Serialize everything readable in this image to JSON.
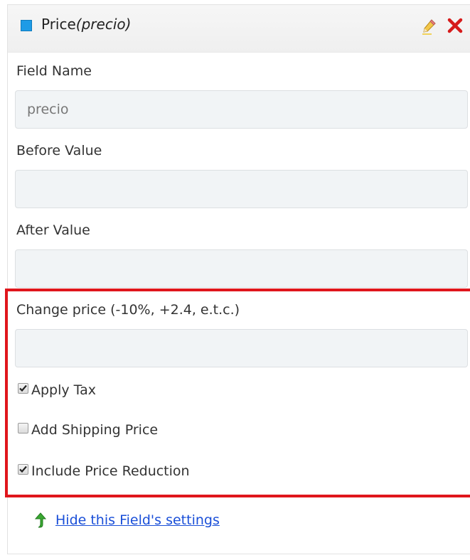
{
  "header": {
    "title_main": "Price",
    "title_key": "(precio)",
    "color": "#1e9be6",
    "edit_icon": "pencil-icon",
    "delete_icon": "close-icon"
  },
  "fields": {
    "field_name": {
      "label": "Field Name",
      "value": "precio",
      "placeholder": ""
    },
    "before_value": {
      "label": "Before Value",
      "value": "",
      "placeholder": ""
    },
    "after_value": {
      "label": "After Value",
      "value": "",
      "placeholder": ""
    },
    "change_price": {
      "label": "Change price (-10%, +2.4, e.t.c.)",
      "value": "",
      "placeholder": ""
    }
  },
  "options": [
    {
      "label": "Apply Tax",
      "checked": true
    },
    {
      "label": "Add Shipping Price",
      "checked": false
    },
    {
      "label": "Include Price Reduction",
      "checked": true
    }
  ],
  "footer": {
    "hide_link": "Hide this Field's settings",
    "arrow_icon": "up-arrow-icon"
  },
  "colors": {
    "highlight": "#e0161c",
    "link": "#1a4fd8",
    "input_bg": "#f1f4f6"
  }
}
